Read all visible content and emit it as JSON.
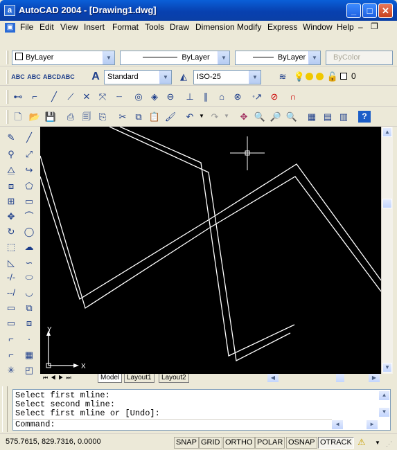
{
  "window": {
    "app_icon": "a",
    "title": "AutoCAD 2004 - [Drawing1.dwg]",
    "minimize": "_",
    "maximize": "□",
    "close": "✕"
  },
  "menu": {
    "items": [
      "File",
      "Edit",
      "View",
      "Insert",
      "Format",
      "Tools",
      "Draw",
      "Dimension",
      "Modify",
      "Express",
      "Window",
      "Help"
    ],
    "doc_min": "–",
    "doc_restore": "❐"
  },
  "layers_toolbar": {
    "color": "ByLayer",
    "linetype": "ByLayer",
    "lineweight": "ByLayer",
    "plotstyle": "ByColor",
    "layer": "0"
  },
  "styles_toolbar": {
    "text_style": "Standard",
    "dim_style": "ISO-25"
  },
  "tabs": [
    "Model",
    "Layout1",
    "Layout2"
  ],
  "command": {
    "lines": [
      "Select first mline:",
      "Select second mline:",
      "Select first mline or [Undo]:"
    ],
    "prompt": "Command:"
  },
  "status": {
    "coords": "575.7615, 829.7316, 0.0000",
    "buttons": [
      "SNAP",
      "GRID",
      "ORTHO",
      "POLAR",
      "OSNAP",
      "OTRACK"
    ],
    "active": "OTRACK"
  },
  "ucs": {
    "x_label": "X",
    "y_label": "Y"
  },
  "colors": {
    "canvas": "#000000",
    "title_bar": "#0a5fd8",
    "lines": "#ffffff"
  }
}
